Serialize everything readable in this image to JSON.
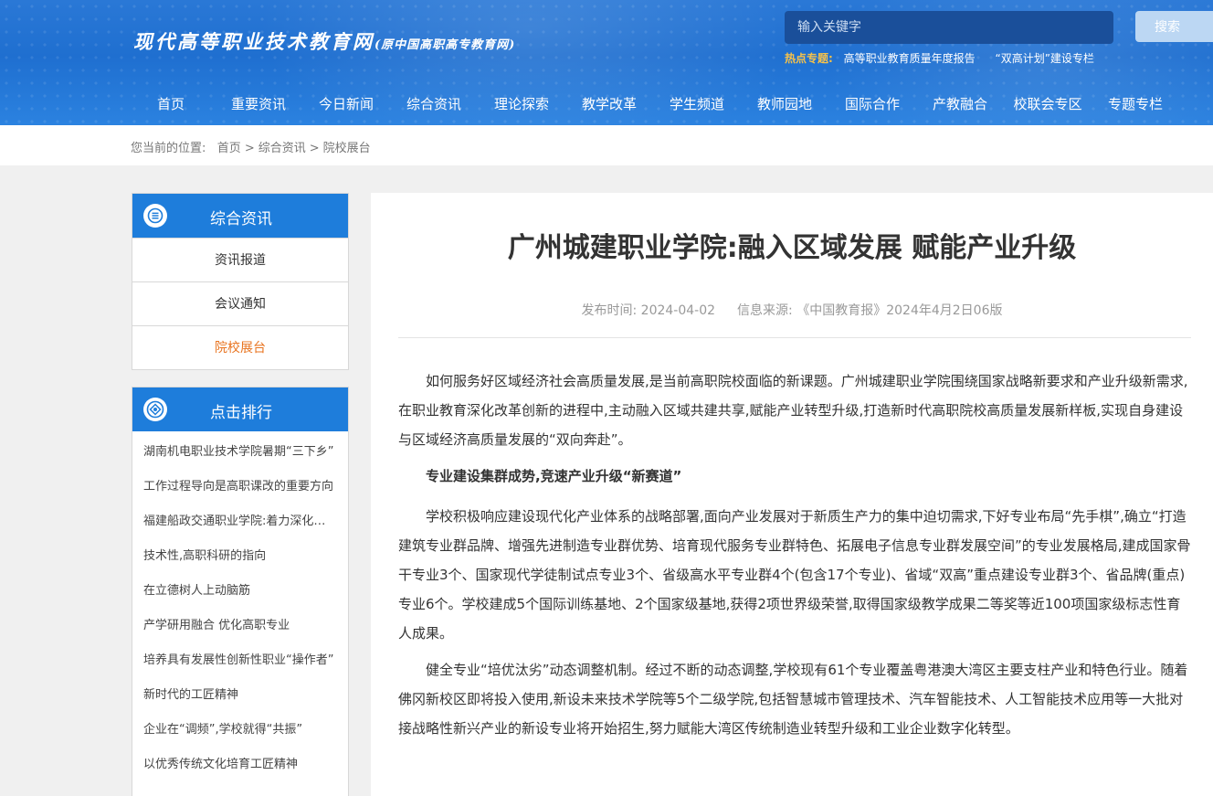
{
  "header": {
    "site_name": "现代高等职业技术教育网",
    "site_subname": "(原中国高职高专教育网)",
    "search_placeholder": "输入关键字",
    "search_button": "搜索",
    "hot_label": "热点专题:",
    "hot_topics": [
      "高等职业教育质量年度报告",
      "“双高计划”建设专栏"
    ]
  },
  "nav": [
    "首页",
    "重要资讯",
    "今日新闻",
    "综合资讯",
    "理论探索",
    "教学改革",
    "学生频道",
    "教师园地",
    "国际合作",
    "产教融合",
    "校联会专区",
    "专题专栏"
  ],
  "breadcrumb": {
    "prefix": "您当前的位置:",
    "items": [
      "首页",
      "综合资讯",
      "院校展台"
    ],
    "separator": ">"
  },
  "sidebar": {
    "category": {
      "title": "综合资讯",
      "items": [
        "资讯报道",
        "会议通知",
        "院校展台"
      ],
      "active_index": 2
    },
    "ranking": {
      "title": "点击排行",
      "items": [
        "湖南机电职业技术学院暑期“三下乡”",
        "工作过程导向是高职课改的重要方向",
        "福建船政交通职业学院:着力深化改革",
        "技术性,高职科研的指向",
        "在立德树人上动脑筋",
        "产学研用融合 优化高职专业",
        "培养具有发展性创新性职业“操作者”",
        "新时代的工匠精神",
        "企业在“调频”,学校就得“共振”",
        "以优秀传统文化培育工匠精神"
      ]
    }
  },
  "article": {
    "title": "广州城建职业学院:融入区域发展 赋能产业升级",
    "publish_label": "发布时间:",
    "publish_date": "2024-04-02",
    "source_label": "信息来源:",
    "source": "《中国教育报》2024年4月2日06版",
    "paragraphs": [
      "如何服务好区域经济社会高质量发展,是当前高职院校面临的新课题。广州城建职业学院围绕国家战略新要求和产业升级新需求,在职业教育深化改革创新的进程中,主动融入区域共建共享,赋能产业转型升级,打造新时代高职院校高质量发展新样板,实现自身建设与区域经济高质量发展的“双向奔赴”。",
      "专业建设集群成势,竞速产业升级“新赛道”",
      "学校积极响应建设现代化产业体系的战略部署,面向产业发展对于新质生产力的集中迫切需求,下好专业布局“先手棋”,确立“打造建筑专业群品牌、增强先进制造专业群优势、培育现代服务专业群特色、拓展电子信息专业群发展空间”的专业发展格局,建成国家骨干专业3个、国家现代学徒制试点专业3个、省级高水平专业群4个(包含17个专业)、省域“双高”重点建设专业群3个、省品牌(重点)专业6个。学校建成5个国际训练基地、2个国家级基地,获得2项世界级荣誉,取得国家级教学成果二等奖等近100项国家级标志性育人成果。",
      "健全专业“培优汰劣”动态调整机制。经过不断的动态调整,学校现有61个专业覆盖粤港澳大湾区主要支柱产业和特色行业。随着佛冈新校区即将投入使用,新设未来技术学院等5个二级学院,包括智慧城市管理技术、汽车智能技术、人工智能技术应用等一大批对接战略性新兴产业的新设专业将开始招生,努力赋能大湾区传统制造业转型升级和工业企业数字化转型。"
    ]
  },
  "colors": {
    "header_blue": "#1f6fd0",
    "panel_blue": "#1e7ddb",
    "active_orange": "#e8731e",
    "hot_label_yellow": "#f6c24a"
  }
}
